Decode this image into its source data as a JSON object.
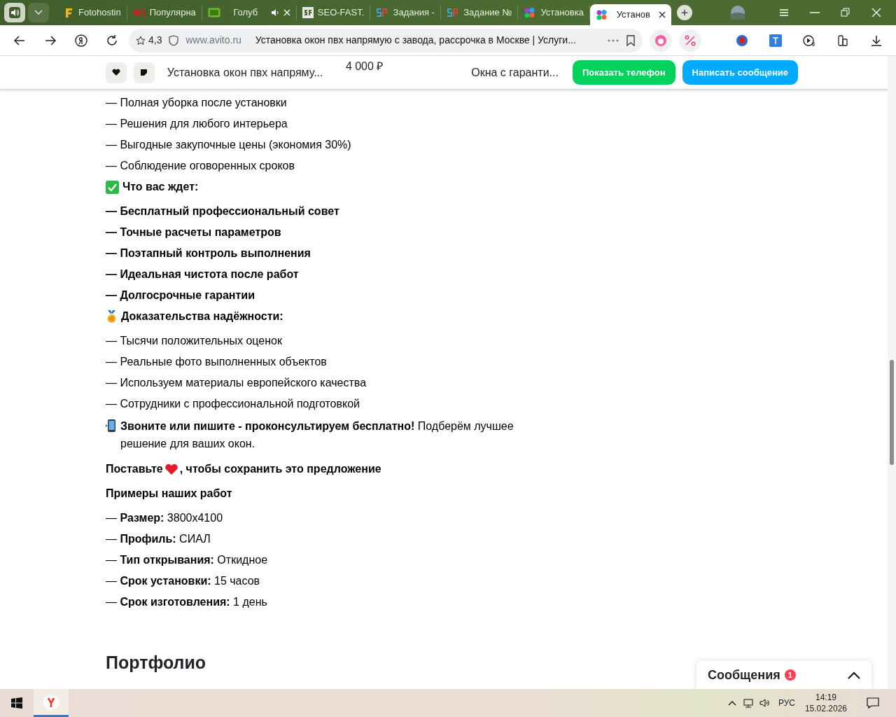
{
  "browser": {
    "tabs": [
      {
        "title": "Fotohostin",
        "selected": false,
        "audio": false,
        "closable": false
      },
      {
        "title": "Популярна",
        "selected": false,
        "audio": false,
        "closable": false
      },
      {
        "title": "Голуб",
        "selected": false,
        "audio": true,
        "closable": true
      },
      {
        "title": "SEO-FAST.",
        "selected": false,
        "audio": false,
        "closable": false
      },
      {
        "title": "Задания -",
        "selected": false,
        "audio": false,
        "closable": false
      },
      {
        "title": "Задание №",
        "selected": false,
        "audio": false,
        "closable": false
      },
      {
        "title": "Установка",
        "selected": false,
        "audio": false,
        "closable": false
      },
      {
        "title": "Установ",
        "selected": true,
        "audio": false,
        "closable": true
      }
    ],
    "rating": "4,3",
    "domain": "www.avito.ru",
    "page_title": "Установка окон пвх напрямую с завода, рассрочка в Москве | Услуги..."
  },
  "sticky_header": {
    "title": "Установка окон пвх напряму...",
    "price": "4 000 ₽",
    "seller": "Окна с гаранти...",
    "buttons": [
      {
        "label": "Показать телефон",
        "kind": "phone"
      },
      {
        "label": "Написать сообщение",
        "kind": "message"
      }
    ]
  },
  "content": [
    {
      "kind": "text",
      "text": "— Полная уборка после установки"
    },
    {
      "kind": "text",
      "text": "— Решения для любого интерьера"
    },
    {
      "kind": "text",
      "text": "— Выгодные закупочные цены (экономия 30%)"
    },
    {
      "kind": "text",
      "text": "— Соблюдение оговоренных сроков"
    },
    {
      "kind": "checked",
      "text": "Что вас ждет:"
    },
    {
      "kind": "bold",
      "text": "— Бесплатный профессиональный совет"
    },
    {
      "kind": "bold",
      "text": "— Точные расчеты параметров"
    },
    {
      "kind": "bold",
      "text": "— Поэтапный контроль выполнения"
    },
    {
      "kind": "bold",
      "text": "— Идеальная чистота после работ"
    },
    {
      "kind": "bold",
      "text": "— Долгосрочные гарантии"
    },
    {
      "kind": "medal",
      "text": "Доказательства надёжности:"
    },
    {
      "kind": "text",
      "text": "— Тысячи положительных оценок"
    },
    {
      "kind": "text",
      "text": "— Реальные фото выполненных объектов"
    },
    {
      "kind": "text",
      "text": "— Используем материалы европейского качества"
    },
    {
      "kind": "text",
      "text": "— Сотрудники с профессиональной подготовкой"
    },
    {
      "kind": "callout",
      "text": "**Звоните или пишите - проконсультируем бесплатно!** Подберём лучшее решение для ваших окон."
    },
    {
      "kind": "like",
      "text": "Поставьте",
      "text_after": ", чтобы сохранить это предложение"
    },
    {
      "kind": "heading",
      "text": "Примеры наших работ"
    },
    {
      "kind": "rich",
      "text": "— **Размер:** 3800x4100"
    },
    {
      "kind": "rich",
      "text": "— **Профиль:** СИАЛ"
    },
    {
      "kind": "rich",
      "text": "— **Тип открывания:** Откидное"
    },
    {
      "kind": "rich",
      "text": "— **Срок установки:** 15 часов"
    },
    {
      "kind": "rich",
      "text": "— **Срок изготовления:** 1 день"
    }
  ],
  "section_title": "Портфолио",
  "messages": {
    "label": "Сообщения",
    "count": "1"
  },
  "taskbar": {
    "language": "РУС",
    "time": "14:19",
    "date": "15.02.2026"
  }
}
